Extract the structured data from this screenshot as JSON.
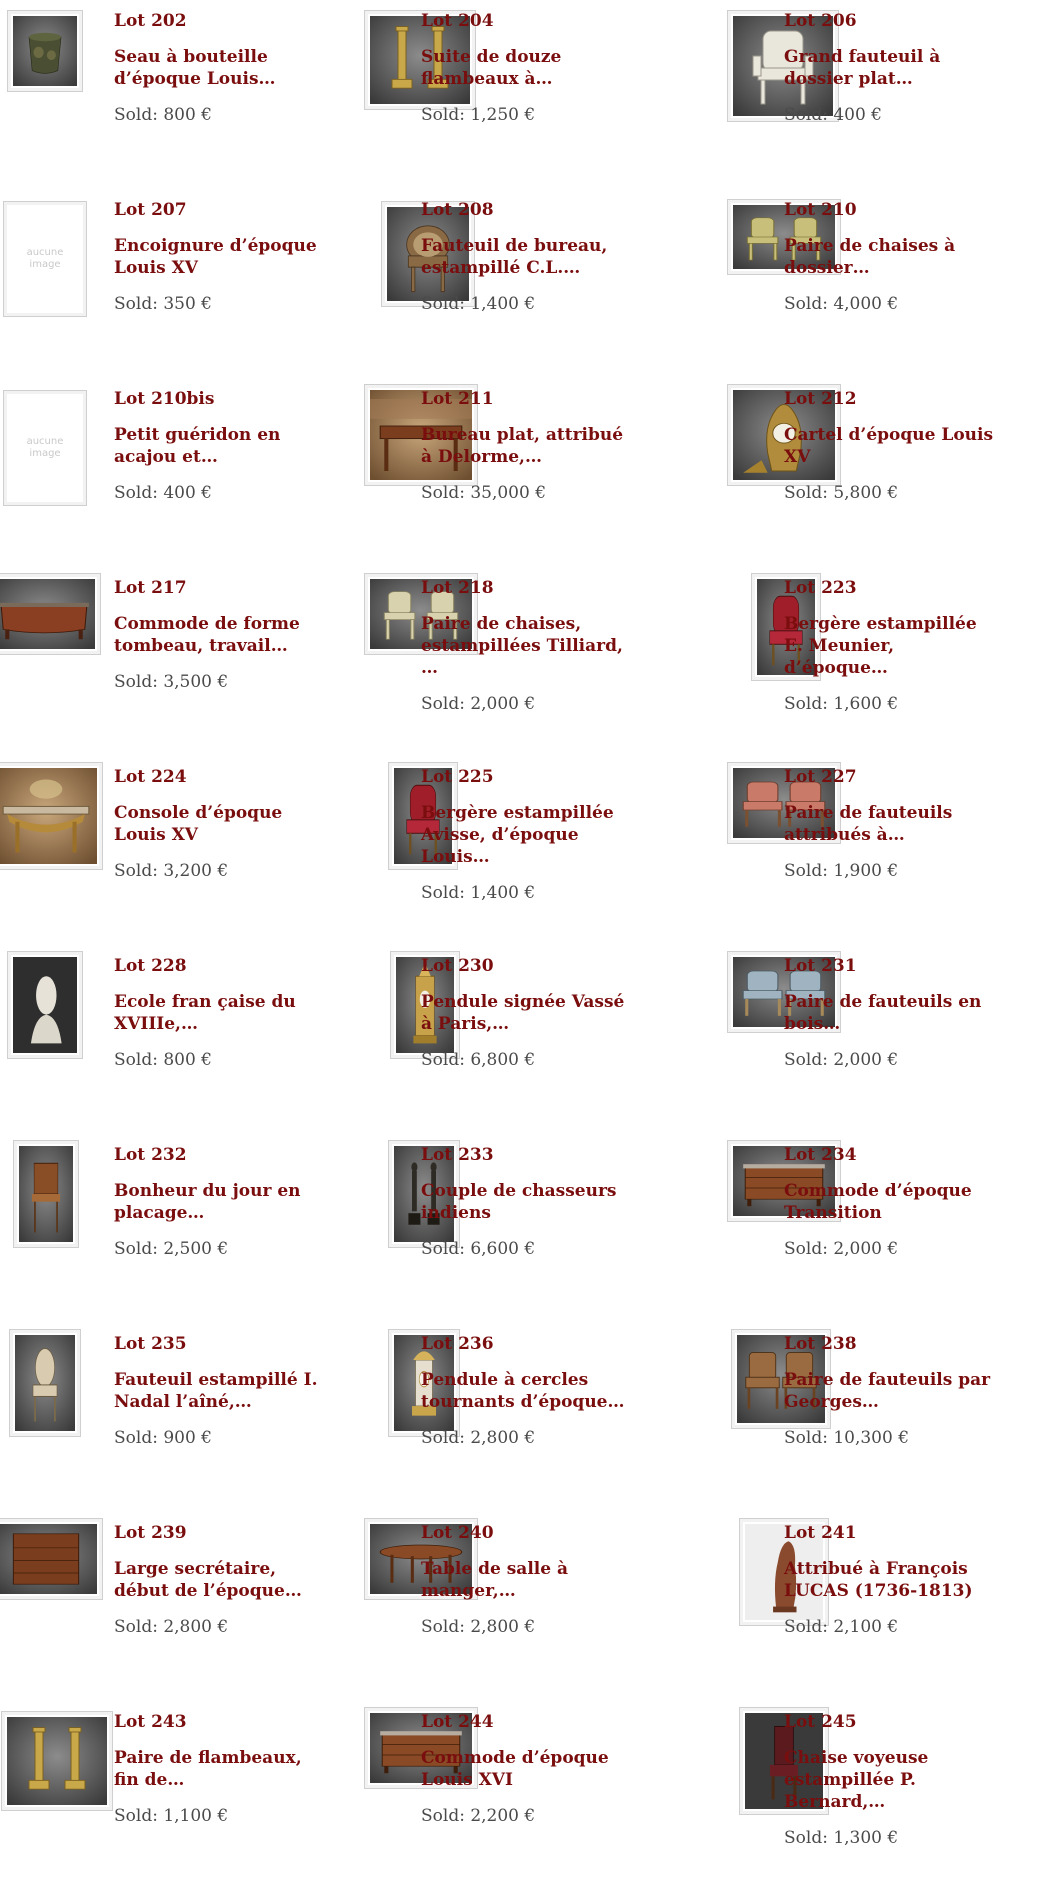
{
  "sold_prefix": "Sold:",
  "colors": {
    "accent": "#7a0d0d",
    "text": "#4a4a4a",
    "frame": "#cfcfcf",
    "placeholder": "#c9c9c9"
  },
  "lots": [
    {
      "lot": "Lot 202",
      "title": "Seau à bouteille d’époque Louis…",
      "sold": "Sold: 800 €",
      "image": "bucket",
      "image_alt": ""
    },
    {
      "lot": "Lot 204",
      "title": "Suite de douze flambeaux à…",
      "sold": "Sold: 1,250 €",
      "image": "candlesticks",
      "image_alt": ""
    },
    {
      "lot": "Lot 206",
      "title": "Grand fauteuil à dossier plat…",
      "sold": "Sold: 400 €",
      "image": "armchair-white",
      "image_alt": ""
    },
    {
      "lot": "Lot 207",
      "title": "Encoignure d’époque Louis XV",
      "sold": "Sold: 350 €",
      "image": "none",
      "image_alt": "aucune image"
    },
    {
      "lot": "Lot 208",
      "title": "Fauteuil de bureau, estampillé C.L.…",
      "sold": "Sold: 1,400 €",
      "image": "desk-chair",
      "image_alt": ""
    },
    {
      "lot": "Lot 210",
      "title": "Paire de chaises à dossier…",
      "sold": "Sold: 4,000 €",
      "image": "chairs-pair",
      "image_alt": ""
    },
    {
      "lot": "Lot 210bis",
      "title": "Petit guéridon en acajou et…",
      "sold": "Sold: 400 €",
      "image": "none",
      "image_alt": "aucune image"
    },
    {
      "lot": "Lot 211",
      "title": "Bureau plat, attribué à Delorme,…",
      "sold": "Sold: 35,000 €",
      "image": "bureau",
      "image_alt": ""
    },
    {
      "lot": "Lot 212",
      "title": "Cartel d’époque Louis XV",
      "sold": "Sold: 5,800 €",
      "image": "cartel",
      "image_alt": ""
    },
    {
      "lot": "Lot 217",
      "title": "Commode de forme tombeau, travail…",
      "sold": "Sold: 3,500 €",
      "image": "commode-tombeau",
      "image_alt": ""
    },
    {
      "lot": "Lot 218",
      "title": "Paire de chaises, estampillées Tilliard, …",
      "sold": "Sold: 2,000 €",
      "image": "chairs-pair-light",
      "image_alt": ""
    },
    {
      "lot": "Lot 223",
      "title": "Bergère estampillée E. Meunier, d’époque…",
      "sold": "Sold: 1,600 €",
      "image": "bergere-red",
      "image_alt": ""
    },
    {
      "lot": "Lot 224",
      "title": "Console d’époque Louis XV",
      "sold": "Sold: 3,200 €",
      "image": "console",
      "image_alt": ""
    },
    {
      "lot": "Lot 225",
      "title": "Bergère estampillée Avisse, d’époque Louis…",
      "sold": "Sold: 1,400 €",
      "image": "bergere-red",
      "image_alt": ""
    },
    {
      "lot": "Lot 227",
      "title": "Paire de fauteuils attribués à…",
      "sold": "Sold: 1,900 €",
      "image": "armchairs-pink",
      "image_alt": ""
    },
    {
      "lot": "Lot 228",
      "title": "Ecole fran çaise du XVIIIe,…",
      "sold": "Sold: 800 €",
      "image": "bust",
      "image_alt": ""
    },
    {
      "lot": "Lot 230",
      "title": "Pendule signée Vassé à Paris,…",
      "sold": "Sold: 6,800 €",
      "image": "pendule-tall",
      "image_alt": ""
    },
    {
      "lot": "Lot 231",
      "title": "Paire de fauteuils en bois…",
      "sold": "Sold: 2,000 €",
      "image": "armchairs-blue",
      "image_alt": ""
    },
    {
      "lot": "Lot 232",
      "title": "Bonheur du jour en placage…",
      "sold": "Sold: 2,500 €",
      "image": "bonheur",
      "image_alt": ""
    },
    {
      "lot": "Lot 233",
      "title": "Couple de chasseurs indiens",
      "sold": "Sold: 6,600 €",
      "image": "statuettes",
      "image_alt": ""
    },
    {
      "lot": "Lot 234",
      "title": "Commode d’époque Transition",
      "sold": "Sold: 2,000 €",
      "image": "commode",
      "image_alt": ""
    },
    {
      "lot": "Lot 235",
      "title": "Fauteuil estampillé I. Nadal l’aîné,…",
      "sold": "Sold: 900 €",
      "image": "medallion-chair",
      "image_alt": ""
    },
    {
      "lot": "Lot 236",
      "title": "Pendule à cercles tournants d’époque…",
      "sold": "Sold: 2,800 €",
      "image": "pendule-temple",
      "image_alt": ""
    },
    {
      "lot": "Lot 238",
      "title": "Paire de fauteuils par Georges…",
      "sold": "Sold: 10,300 €",
      "image": "armchairs-wood",
      "image_alt": ""
    },
    {
      "lot": "Lot 239",
      "title": "Large secrétaire, début de l’époque…",
      "sold": "Sold: 2,800 €",
      "image": "secretaire",
      "image_alt": ""
    },
    {
      "lot": "Lot 240",
      "title": "Table de salle à manger,…",
      "sold": "Sold: 2,800 €",
      "image": "table",
      "image_alt": ""
    },
    {
      "lot": "Lot 241",
      "title": "Attribué à François LUCAS (1736-1813)",
      "sold": "Sold: 2,100 €",
      "image": "terracotta",
      "image_alt": ""
    },
    {
      "lot": "Lot 243",
      "title": "Paire de flambeaux, fin de…",
      "sold": "Sold: 1,100 €",
      "image": "candlesticks",
      "image_alt": ""
    },
    {
      "lot": "Lot 244",
      "title": "Commode d’époque Louis XVI",
      "sold": "Sold: 2,200 €",
      "image": "commode",
      "image_alt": ""
    },
    {
      "lot": "Lot 245",
      "title": "Chaise voyeuse estampillée P. Bernard,…",
      "sold": "Sold: 1,300 €",
      "image": "voyeuse",
      "image_alt": ""
    }
  ]
}
